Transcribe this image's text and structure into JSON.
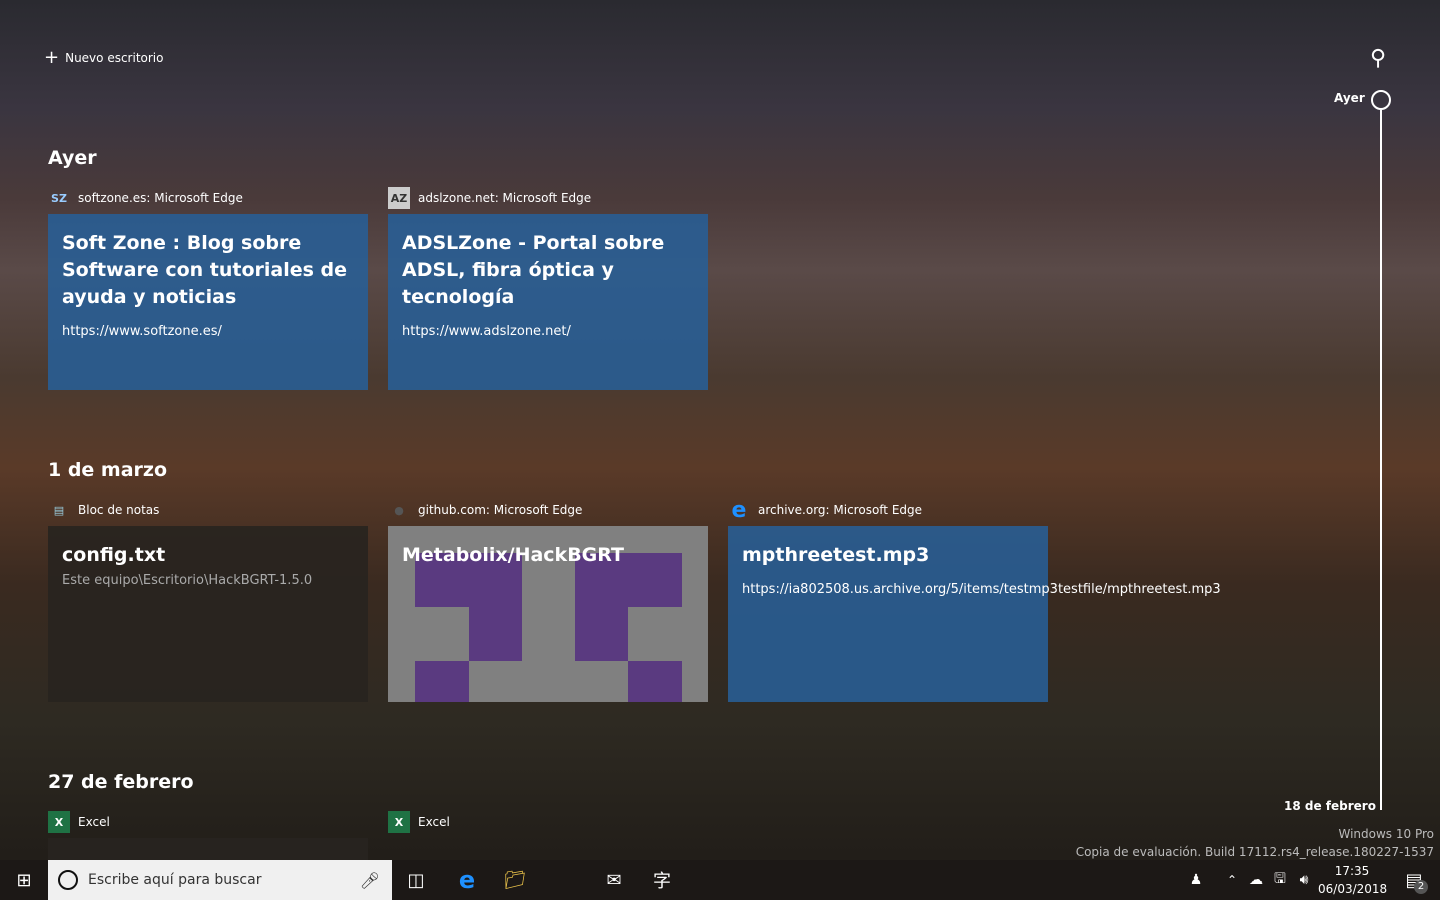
{
  "top": {
    "new_desktop": "Nuevo escritorio",
    "search_icon": "search-icon"
  },
  "timeline": {
    "top_label": "Ayer",
    "bottom_label": "18 de febrero"
  },
  "sections": [
    {
      "title": "Ayer",
      "items": [
        {
          "source": "softzone.es: Microsoft Edge",
          "title": "Soft Zone : Blog sobre Software con tutoriales de ayuda y noticias",
          "url": "https://www.softzone.es/"
        },
        {
          "source": "adslzone.net: Microsoft Edge",
          "title": "ADSLZone - Portal sobre ADSL, fibra óptica y tecnología",
          "url": "https://www.adslzone.net/"
        }
      ]
    },
    {
      "title": "1 de marzo",
      "items": [
        {
          "source": "Bloc de notas",
          "title": "config.txt",
          "url": "Este equipo\\Escritorio\\HackBGRT-1.5.0"
        },
        {
          "source": "github.com: Microsoft Edge",
          "title": "Metabolix/HackBGRT"
        },
        {
          "source": "archive.org: Microsoft Edge",
          "title": "mpthreetest.mp3",
          "url": "https://ia802508.us.archive.org/5/items/testmp3testfile/mpthreetest.mp3"
        }
      ]
    },
    {
      "title": "27 de febrero",
      "items": [
        {
          "source": "Excel"
        },
        {
          "source": "Excel"
        }
      ]
    }
  ],
  "watermark": {
    "line1": "Windows 10 Pro",
    "line2": "Copia de evaluación. Build 17112.rs4_release.180227-1537"
  },
  "taskbar": {
    "search_placeholder": "Escribe aquí para buscar",
    "time": "17:35",
    "date": "06/03/2018",
    "notifications": "2"
  },
  "colors": {
    "card_blue": "#285f96",
    "identicon": "#5a3a80"
  }
}
